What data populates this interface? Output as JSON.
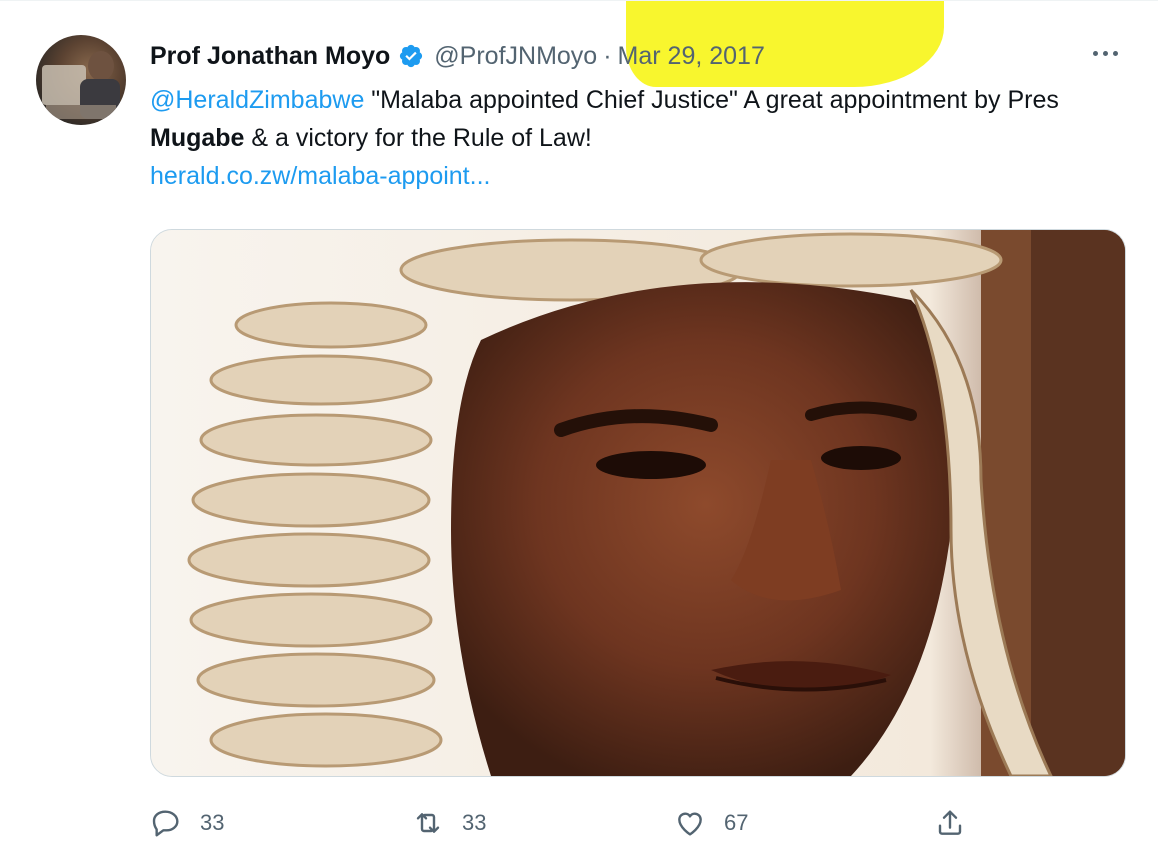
{
  "tweet": {
    "author_name": "Prof Jonathan Moyo",
    "handle": "@ProfJNMoyo",
    "separator": "·",
    "date": "Mar 29, 2017",
    "mention": "@HeraldZimbabwe",
    "text_part1": " \"Malaba appointed Chief Justice\" A great appointment by Pres ",
    "text_bold": "Mugabe",
    "text_part2": " & a victory for the Rule of Law!",
    "link": "herald.co.zw/malaba-appoint..."
  },
  "stats": {
    "replies": "33",
    "retweets": "33",
    "likes": "67"
  },
  "icons": {
    "verified": "verified-badge-icon",
    "more": "more-options-icon",
    "reply": "reply-icon",
    "retweet": "retweet-icon",
    "like": "heart-icon",
    "share": "share-icon"
  },
  "colors": {
    "link": "#1d9bf0",
    "muted": "#536471",
    "highlight": "#f7f400"
  }
}
